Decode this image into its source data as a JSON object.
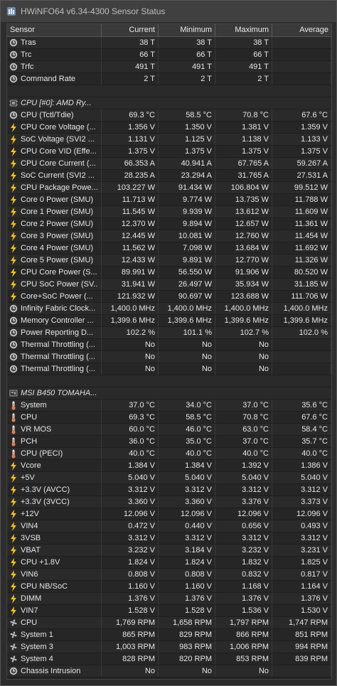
{
  "window": {
    "title": "HWiNFO64 v6.34-4300 Sensor Status"
  },
  "columns": [
    "Sensor",
    "Current",
    "Minimum",
    "Maximum",
    "Average"
  ],
  "icon_colors": {
    "clock": "#cfcfcf",
    "bolt": "#f3c21a",
    "temp": "#e27a4e",
    "fan": "#bfbfbf",
    "chip": "#dcdcdc"
  },
  "sections": [
    {
      "group": "",
      "rows": [
        {
          "icon": "clock-icon",
          "name": "Tras",
          "cur": "38 T",
          "min": "38 T",
          "max": "38 T",
          "avg": ""
        },
        {
          "icon": "clock-icon",
          "name": "Trc",
          "cur": "66 T",
          "min": "66 T",
          "max": "66 T",
          "avg": ""
        },
        {
          "icon": "clock-icon",
          "name": "Trfc",
          "cur": "491 T",
          "min": "491 T",
          "max": "491 T",
          "avg": ""
        },
        {
          "icon": "clock-icon",
          "name": "Command Rate",
          "cur": "2 T",
          "min": "2 T",
          "max": "2 T",
          "avg": ""
        }
      ]
    },
    {
      "group": "CPU [#0]: AMD Ry...",
      "rows": [
        {
          "icon": "clock-icon",
          "name": "CPU (Tctl/Tdie)",
          "cur": "69.3 °C",
          "min": "58.5 °C",
          "max": "70.8 °C",
          "avg": "67.6 °C"
        },
        {
          "icon": "bolt-icon",
          "name": "CPU Core Voltage (...",
          "cur": "1.356 V",
          "min": "1.350 V",
          "max": "1.381 V",
          "avg": "1.359 V"
        },
        {
          "icon": "bolt-icon",
          "name": "SoC Voltage (SVI2 ...",
          "cur": "1.131 V",
          "min": "1.125 V",
          "max": "1.138 V",
          "avg": "1.133 V"
        },
        {
          "icon": "bolt-icon",
          "name": "CPU Core VID (Effe...",
          "cur": "1.375 V",
          "min": "1.375 V",
          "max": "1.375 V",
          "avg": "1.375 V"
        },
        {
          "icon": "bolt-icon",
          "name": "CPU Core Current (...",
          "cur": "66.353 A",
          "min": "40.941 A",
          "max": "67.765 A",
          "avg": "59.267 A"
        },
        {
          "icon": "bolt-icon",
          "name": "SoC Current (SVI2 ...",
          "cur": "28.235 A",
          "min": "23.294 A",
          "max": "31.765 A",
          "avg": "27.531 A"
        },
        {
          "icon": "bolt-icon",
          "name": "CPU Package Powe...",
          "cur": "103.227 W",
          "min": "91.434 W",
          "max": "106.804 W",
          "avg": "99.512 W"
        },
        {
          "icon": "bolt-icon",
          "name": "Core 0 Power (SMU)",
          "cur": "11.713 W",
          "min": "9.774 W",
          "max": "13.735 W",
          "avg": "11.788 W"
        },
        {
          "icon": "bolt-icon",
          "name": "Core 1 Power (SMU)",
          "cur": "11.545 W",
          "min": "9.939 W",
          "max": "13.612 W",
          "avg": "11.609 W"
        },
        {
          "icon": "bolt-icon",
          "name": "Core 2 Power (SMU)",
          "cur": "12.370 W",
          "min": "9.894 W",
          "max": "12.657 W",
          "avg": "11.361 W"
        },
        {
          "icon": "bolt-icon",
          "name": "Core 3 Power (SMU)",
          "cur": "12.445 W",
          "min": "10.081 W",
          "max": "12.760 W",
          "avg": "11.454 W"
        },
        {
          "icon": "bolt-icon",
          "name": "Core 4 Power (SMU)",
          "cur": "11.562 W",
          "min": "7.098 W",
          "max": "13.684 W",
          "avg": "11.692 W"
        },
        {
          "icon": "bolt-icon",
          "name": "Core 5 Power (SMU)",
          "cur": "12.433 W",
          "min": "9.891 W",
          "max": "12.770 W",
          "avg": "11.326 W"
        },
        {
          "icon": "bolt-icon",
          "name": "CPU Core Power (S...",
          "cur": "89.991 W",
          "min": "56.550 W",
          "max": "91.906 W",
          "avg": "80.520 W"
        },
        {
          "icon": "bolt-icon",
          "name": "CPU SoC Power (SV...",
          "cur": "31.941 W",
          "min": "26.497 W",
          "max": "35.934 W",
          "avg": "31.185 W"
        },
        {
          "icon": "bolt-icon",
          "name": "Core+SoC Power (...",
          "cur": "121.932 W",
          "min": "90.697 W",
          "max": "123.688 W",
          "avg": "111.706 W"
        },
        {
          "icon": "clock-icon",
          "name": "Infinity Fabric Clock...",
          "cur": "1,400.0 MHz",
          "min": "1,400.0 MHz",
          "max": "1,400.0 MHz",
          "avg": "1,400.0 MHz"
        },
        {
          "icon": "clock-icon",
          "name": "Memory Controller ...",
          "cur": "1,399.6 MHz",
          "min": "1,399.6 MHz",
          "max": "1,399.6 MHz",
          "avg": "1,399.6 MHz"
        },
        {
          "icon": "clock-icon",
          "name": "Power Reporting D...",
          "cur": "102.2 %",
          "min": "101.1 %",
          "max": "102.7 %",
          "avg": "102.0 %"
        },
        {
          "icon": "clock-icon",
          "name": "Thermal Throttling (...",
          "cur": "No",
          "min": "No",
          "max": "No",
          "avg": ""
        },
        {
          "icon": "clock-icon",
          "name": "Thermal Throttling (...",
          "cur": "No",
          "min": "No",
          "max": "No",
          "avg": ""
        },
        {
          "icon": "clock-icon",
          "name": "Thermal Throttling (...",
          "cur": "No",
          "min": "No",
          "max": "No",
          "avg": ""
        }
      ]
    },
    {
      "group": "MSI B450 TOMAHA...",
      "rows": [
        {
          "icon": "thermometer-icon",
          "name": "System",
          "cur": "37.0 °C",
          "min": "34.0 °C",
          "max": "37.0 °C",
          "avg": "35.6 °C"
        },
        {
          "icon": "thermometer-icon",
          "name": "CPU",
          "cur": "69.3 °C",
          "min": "58.5 °C",
          "max": "70.8 °C",
          "avg": "67.6 °C"
        },
        {
          "icon": "thermometer-icon",
          "name": "VR MOS",
          "cur": "60.0 °C",
          "min": "46.0 °C",
          "max": "63.0 °C",
          "avg": "58.4 °C"
        },
        {
          "icon": "thermometer-icon",
          "name": "PCH",
          "cur": "36.0 °C",
          "min": "35.0 °C",
          "max": "37.0 °C",
          "avg": "35.7 °C"
        },
        {
          "icon": "thermometer-icon",
          "name": "CPU (PECI)",
          "cur": "40.0 °C",
          "min": "40.0 °C",
          "max": "40.0 °C",
          "avg": "40.0 °C"
        },
        {
          "icon": "bolt-icon",
          "name": "Vcore",
          "cur": "1.384 V",
          "min": "1.384 V",
          "max": "1.392 V",
          "avg": "1.386 V"
        },
        {
          "icon": "bolt-icon",
          "name": "+5V",
          "cur": "5.040 V",
          "min": "5.040 V",
          "max": "5.040 V",
          "avg": "5.040 V"
        },
        {
          "icon": "bolt-icon",
          "name": "+3.3V (AVCC)",
          "cur": "3.312 V",
          "min": "3.312 V",
          "max": "3.312 V",
          "avg": "3.312 V"
        },
        {
          "icon": "bolt-icon",
          "name": "+3.3V (3VCC)",
          "cur": "3.360 V",
          "min": "3.360 V",
          "max": "3.376 V",
          "avg": "3.373 V"
        },
        {
          "icon": "bolt-icon",
          "name": "+12V",
          "cur": "12.096 V",
          "min": "12.096 V",
          "max": "12.096 V",
          "avg": "12.096 V"
        },
        {
          "icon": "bolt-icon",
          "name": "VIN4",
          "cur": "0.472 V",
          "min": "0.440 V",
          "max": "0.656 V",
          "avg": "0.493 V"
        },
        {
          "icon": "bolt-icon",
          "name": "3VSB",
          "cur": "3.312 V",
          "min": "3.312 V",
          "max": "3.312 V",
          "avg": "3.312 V"
        },
        {
          "icon": "bolt-icon",
          "name": "VBAT",
          "cur": "3.232 V",
          "min": "3.184 V",
          "max": "3.232 V",
          "avg": "3.231 V"
        },
        {
          "icon": "bolt-icon",
          "name": "CPU +1.8V",
          "cur": "1.824 V",
          "min": "1.824 V",
          "max": "1.832 V",
          "avg": "1.825 V"
        },
        {
          "icon": "bolt-icon",
          "name": "VIN6",
          "cur": "0.808 V",
          "min": "0.808 V",
          "max": "0.832 V",
          "avg": "0.817 V"
        },
        {
          "icon": "bolt-icon",
          "name": "CPU NB/SoC",
          "cur": "1.160 V",
          "min": "1.160 V",
          "max": "1.168 V",
          "avg": "1.164 V"
        },
        {
          "icon": "bolt-icon",
          "name": "DIMM",
          "cur": "1.376 V",
          "min": "1.376 V",
          "max": "1.376 V",
          "avg": "1.376 V"
        },
        {
          "icon": "bolt-icon",
          "name": "VIN7",
          "cur": "1.528 V",
          "min": "1.528 V",
          "max": "1.536 V",
          "avg": "1.530 V"
        },
        {
          "icon": "fan-icon",
          "name": "CPU",
          "cur": "1,769 RPM",
          "min": "1,658 RPM",
          "max": "1,797 RPM",
          "avg": "1,747 RPM"
        },
        {
          "icon": "fan-icon",
          "name": "System 1",
          "cur": "865 RPM",
          "min": "829 RPM",
          "max": "866 RPM",
          "avg": "851 RPM"
        },
        {
          "icon": "fan-icon",
          "name": "System 3",
          "cur": "1,003 RPM",
          "min": "983 RPM",
          "max": "1,006 RPM",
          "avg": "994 RPM"
        },
        {
          "icon": "fan-icon",
          "name": "System 4",
          "cur": "828 RPM",
          "min": "820 RPM",
          "max": "853 RPM",
          "avg": "839 RPM"
        },
        {
          "icon": "clock-icon",
          "name": "Chassis Intrusion",
          "cur": "No",
          "min": "No",
          "max": "No",
          "avg": ""
        }
      ]
    }
  ]
}
